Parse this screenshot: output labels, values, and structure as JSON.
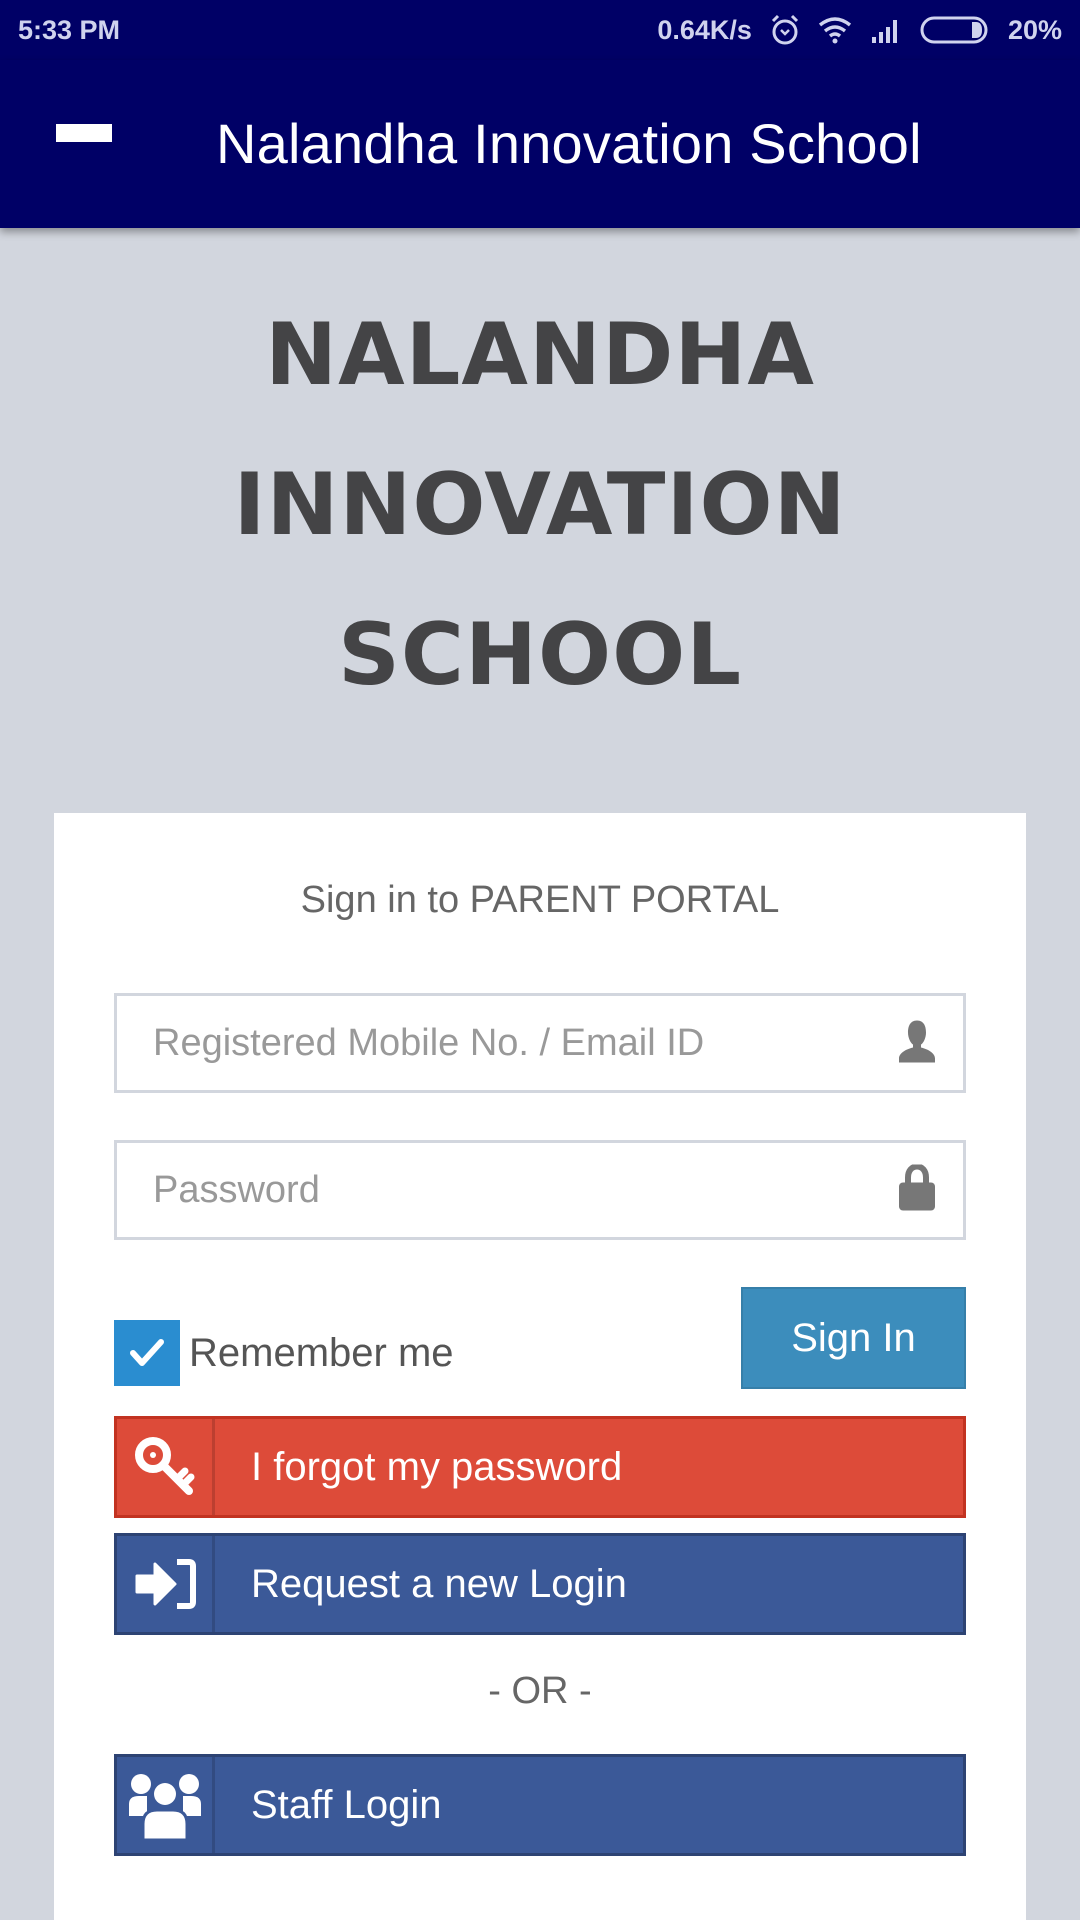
{
  "status_bar": {
    "time": "5:33 PM",
    "network_speed": "0.64K/s",
    "battery_percent": "20%",
    "battery_level": 0.2,
    "icons": [
      "alarm-icon",
      "wifi-icon",
      "signal-icon",
      "battery-icon"
    ]
  },
  "app_bar": {
    "title": "Nalandha Innovation School",
    "menu_icon": "hamburger-menu-icon"
  },
  "brand": {
    "lines": [
      "NALANDHA",
      "INNOVATION",
      "SCHOOL"
    ]
  },
  "login_card": {
    "title": "Sign in to PARENT PORTAL",
    "username": {
      "placeholder": "Registered Mobile No. / Email ID",
      "value": "",
      "icon": "user-icon"
    },
    "password": {
      "placeholder": "Password",
      "value": "",
      "icon": "lock-icon"
    },
    "remember_me": {
      "label": "Remember me",
      "checked": true
    },
    "sign_in_label": "Sign In",
    "forgot_password_label": "I forgot my password",
    "request_login_label": "Request a new Login",
    "or_separator": "- OR -",
    "staff_login_label": "Staff Login"
  },
  "colors": {
    "app_bar": "#000066",
    "background": "#d2d6de",
    "primary": "#3c8dbc",
    "checkbox": "#2a8dd0",
    "danger": "#dd4b39",
    "facebook_blue": "#3b5998",
    "heading_text": "#444446"
  }
}
